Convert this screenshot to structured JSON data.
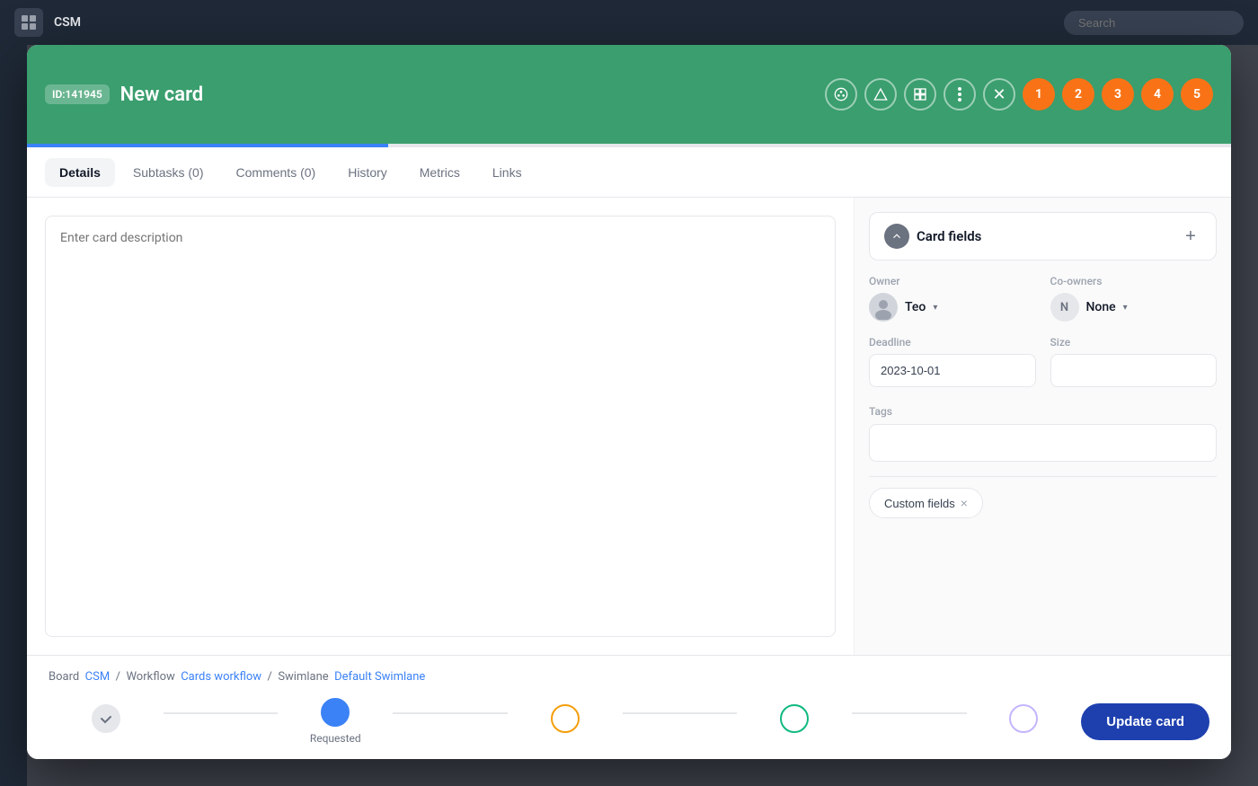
{
  "topbar": {
    "title": "CSM",
    "search_placeholder": "Search"
  },
  "modal": {
    "card_id": "ID:141945",
    "card_title": "New card",
    "header_buttons": {
      "palette": "🎨",
      "triangle": "△",
      "layout": "▦",
      "more": "⋮",
      "close": "✕"
    },
    "avatars": [
      "1",
      "2",
      "3",
      "4",
      "5"
    ]
  },
  "tabs": [
    {
      "id": "details",
      "label": "Details",
      "active": true
    },
    {
      "id": "subtasks",
      "label": "Subtasks (0)",
      "active": false
    },
    {
      "id": "comments",
      "label": "Comments (0)",
      "active": false
    },
    {
      "id": "history",
      "label": "History",
      "active": false
    },
    {
      "id": "metrics",
      "label": "Metrics",
      "active": false
    },
    {
      "id": "links",
      "label": "Links",
      "active": false
    }
  ],
  "description": {
    "placeholder": "Enter card description"
  },
  "card_fields": {
    "title": "Card fields",
    "add_label": "+",
    "owner_label": "Owner",
    "owner_name": "Teo",
    "co_owner_label": "Co-owners",
    "co_owner_name": "None",
    "deadline_label": "Deadline",
    "deadline_value": "2023-10-01",
    "size_label": "Size",
    "size_value": "",
    "tags_label": "Tags",
    "tags_value": "",
    "custom_fields_label": "Custom fields",
    "custom_fields_close": "×"
  },
  "footer": {
    "board_label": "Board",
    "board_link": "CSM",
    "workflow_label": "Workflow",
    "workflow_link": "Cards workflow",
    "swimlane_label": "Swimlane",
    "swimlane_link": "Default Swimlane"
  },
  "status_steps": [
    {
      "id": "done",
      "label": "",
      "state": "completed"
    },
    {
      "id": "requested",
      "label": "Requested",
      "state": "active"
    },
    {
      "id": "step3",
      "label": "",
      "state": "empty"
    },
    {
      "id": "step4",
      "label": "",
      "state": "empty"
    },
    {
      "id": "step5",
      "label": "",
      "state": "empty-outline"
    }
  ],
  "update_button": "Update card"
}
